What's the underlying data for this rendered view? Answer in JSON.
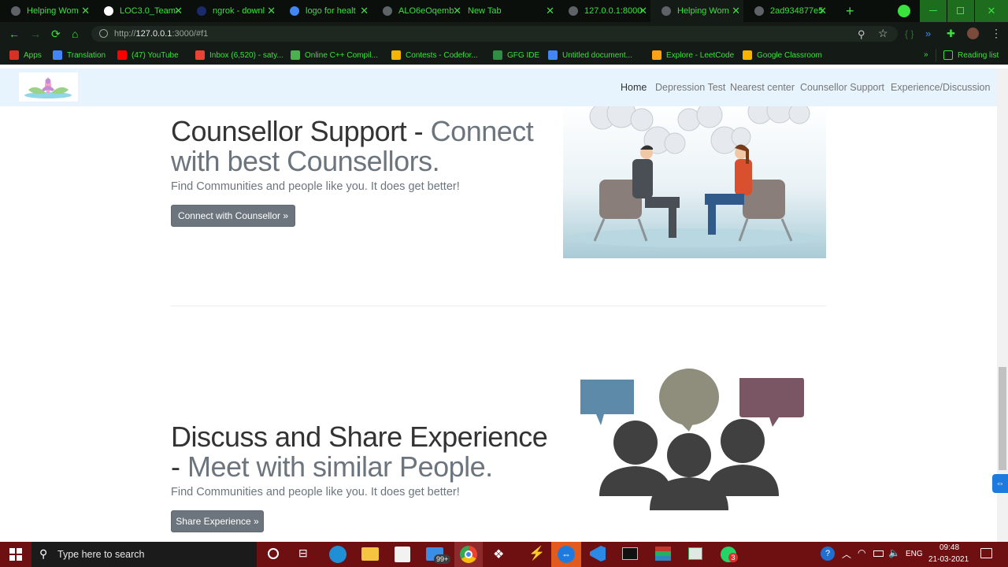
{
  "browser": {
    "tabs": [
      {
        "title": "Helping Wom",
        "fav": "#5f6368"
      },
      {
        "title": "LOC3.0_Team-",
        "fav": "#ffffff"
      },
      {
        "title": "ngrok - downl",
        "fav": "#1b2a6b"
      },
      {
        "title": "logo for healt",
        "fav": "#4285f4"
      },
      {
        "title": "ALO6eOqemb",
        "fav": "#5f6368"
      },
      {
        "title": "New Tab",
        "fav": ""
      },
      {
        "title": "127.0.0.1:8000",
        "fav": "#5f6368"
      },
      {
        "title": "Helping Wom",
        "fav": "#5f6368"
      },
      {
        "title": "2ad934877e5",
        "fav": "#5f6368"
      }
    ],
    "url_prefix": "http://",
    "url_host": "127.0.0.1",
    "url_rest": ":3000/#f1",
    "bookmarks": [
      {
        "label": "Apps",
        "color": "#d93025"
      },
      {
        "label": "Translation",
        "color": "#4285f4"
      },
      {
        "label": "(47) YouTube",
        "color": "#ff0000"
      },
      {
        "label": "Inbox (6,520) - saty...",
        "color": "#ea4335"
      },
      {
        "label": "Online C++ Compil...",
        "color": "#4caf50"
      },
      {
        "label": "Contests - Codefor...",
        "color": "#f4b400"
      },
      {
        "label": "GFG IDE",
        "color": "#2f8d46"
      },
      {
        "label": "Untitled document...",
        "color": "#4285f4"
      },
      {
        "label": "Explore - LeetCode",
        "color": "#ffa116"
      },
      {
        "label": "Google Classroom",
        "color": "#f4b400"
      }
    ],
    "reading_list": "Reading list",
    "overflow": "»"
  },
  "site": {
    "nav": [
      "Home",
      "Depression Test",
      "Nearest center",
      "Counsellor Support",
      "Experience/Discussion"
    ],
    "counsellor": {
      "heading_main": "Counsellor Support - ",
      "heading_muted": "Connect with best Counsellors.",
      "lead": "Find Communities and people like you. It does get better!",
      "button": "Connect with Counsellor »"
    },
    "discuss": {
      "heading_main": "Discuss and Share Experience - ",
      "heading_muted": "Meet with similar People.",
      "lead": "Find Communities and people like you. It does get better!",
      "button": "Share Experience »"
    }
  },
  "taskbar": {
    "search_placeholder": "Type here to search",
    "store_badge": "99+",
    "whatsapp_badge": "3",
    "lang": "ENG",
    "time": "09:48",
    "date": "21-03-2021"
  },
  "colors": {
    "chrome_theme": "#0b0f0c",
    "accent_green": "#39e23c",
    "navbar_bg": "#e7f3fd",
    "button_gray": "#6c757d",
    "taskbar": "#6e0f12"
  }
}
